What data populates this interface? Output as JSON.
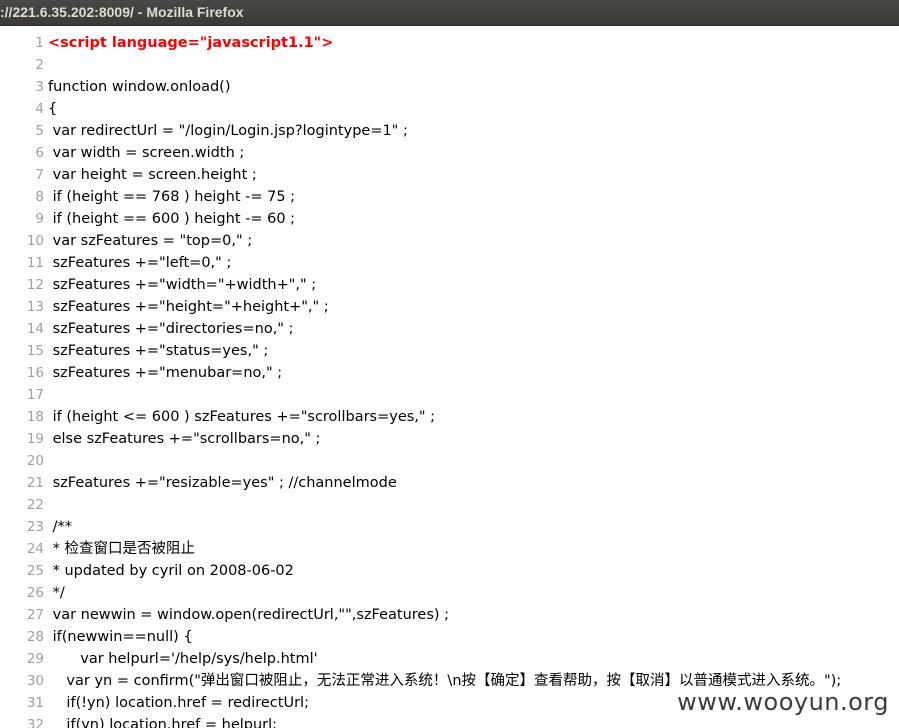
{
  "window": {
    "title": "://221.6.35.202:8009/ - Mozilla Firefox"
  },
  "code": {
    "lines": [
      {
        "num": "1",
        "text": "<script language=\"javascript1.1\">",
        "highlight": true
      },
      {
        "num": "2",
        "text": ""
      },
      {
        "num": "3",
        "text": "function window.onload()"
      },
      {
        "num": "4",
        "text": "{"
      },
      {
        "num": "5",
        "text": " var redirectUrl = \"/login/Login.jsp?logintype=1\" ;"
      },
      {
        "num": "6",
        "text": " var width = screen.width ;"
      },
      {
        "num": "7",
        "text": " var height = screen.height ;"
      },
      {
        "num": "8",
        "text": " if (height == 768 ) height -= 75 ;"
      },
      {
        "num": "9",
        "text": " if (height == 600 ) height -= 60 ;"
      },
      {
        "num": "10",
        "text": " var szFeatures = \"top=0,\" ;"
      },
      {
        "num": "11",
        "text": " szFeatures +=\"left=0,\" ;"
      },
      {
        "num": "12",
        "text": " szFeatures +=\"width=\"+width+\",\" ;"
      },
      {
        "num": "13",
        "text": " szFeatures +=\"height=\"+height+\",\" ;"
      },
      {
        "num": "14",
        "text": " szFeatures +=\"directories=no,\" ;"
      },
      {
        "num": "15",
        "text": " szFeatures +=\"status=yes,\" ;"
      },
      {
        "num": "16",
        "text": " szFeatures +=\"menubar=no,\" ;"
      },
      {
        "num": "17",
        "text": ""
      },
      {
        "num": "18",
        "text": " if (height <= 600 ) szFeatures +=\"scrollbars=yes,\" ;"
      },
      {
        "num": "19",
        "text": " else szFeatures +=\"scrollbars=no,\" ;"
      },
      {
        "num": "20",
        "text": ""
      },
      {
        "num": "21",
        "text": " szFeatures +=\"resizable=yes\" ; //channelmode"
      },
      {
        "num": "22",
        "text": ""
      },
      {
        "num": "23",
        "text": " /**"
      },
      {
        "num": "24",
        "text": " * 检查窗口是否被阻止"
      },
      {
        "num": "25",
        "text": " * updated by cyril on 2008-06-02"
      },
      {
        "num": "26",
        "text": " */"
      },
      {
        "num": "27",
        "text": " var newwin = window.open(redirectUrl,\"\",szFeatures) ;"
      },
      {
        "num": "28",
        "text": " if(newwin==null) {"
      },
      {
        "num": "29",
        "text": "       var helpurl='/help/sys/help.html'"
      },
      {
        "num": "30",
        "text": "    var yn = confirm(\"弹出窗口被阻止，无法正常进入系统！\\n按【确定】查看帮助，按【取消】以普通模式进入系统。\");"
      },
      {
        "num": "31",
        "text": "    if(!yn) location.href = redirectUrl;"
      },
      {
        "num": "32",
        "text": "    if(yn) location.href = helpurl;"
      }
    ]
  },
  "watermark": "www.wooyun.org"
}
